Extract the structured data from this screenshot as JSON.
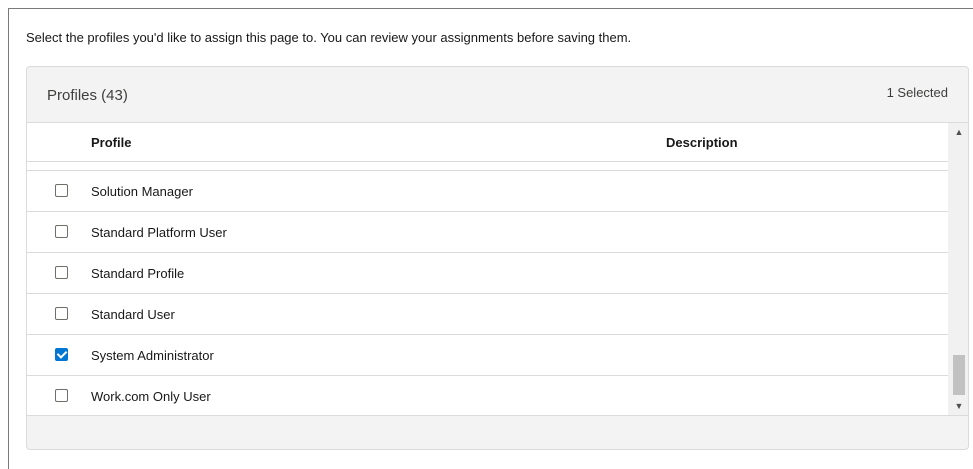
{
  "instructions": "Select the profiles you'd like to assign this page to. You can review your assignments before saving them.",
  "card": {
    "title": "Profiles (43)",
    "selected_count": "1 Selected"
  },
  "table": {
    "columns": {
      "profile": "Profile",
      "description": "Description"
    },
    "rows": [
      {
        "label": "Solution Manager",
        "checked": false
      },
      {
        "label": "Standard Platform User",
        "checked": false
      },
      {
        "label": "Standard Profile",
        "checked": false
      },
      {
        "label": "Standard User",
        "checked": false
      },
      {
        "label": "System Administrator",
        "checked": true
      },
      {
        "label": "Work.com Only User",
        "checked": false
      }
    ]
  },
  "scrollbar": {
    "up_icon": "triangle-up-icon",
    "down_icon": "triangle-down-icon"
  },
  "colors": {
    "checkbox_checked": "#0176d3",
    "card_background": "#f3f3f3",
    "border": "#dddbda"
  }
}
